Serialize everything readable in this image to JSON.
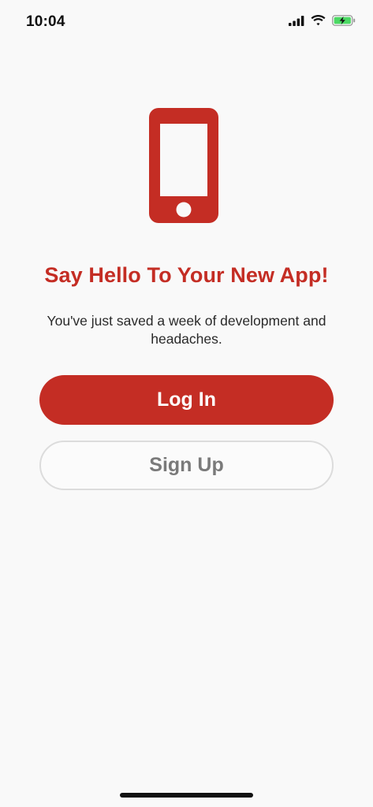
{
  "status_bar": {
    "time": "10:04"
  },
  "icons": {
    "hero": "smartphone-icon",
    "signal": "cellular-signal-icon",
    "wifi": "wifi-icon",
    "battery": "battery-charging-icon"
  },
  "welcome": {
    "headline": "Say Hello To Your New App!",
    "subtext": "You've just saved a week of development and headaches."
  },
  "actions": {
    "login_label": "Log In",
    "signup_label": "Sign Up"
  },
  "colors": {
    "accent": "#c42d24",
    "background": "#f9f9f9",
    "secondary_text": "#7a7a7a",
    "battery_fill": "#4cd964"
  }
}
